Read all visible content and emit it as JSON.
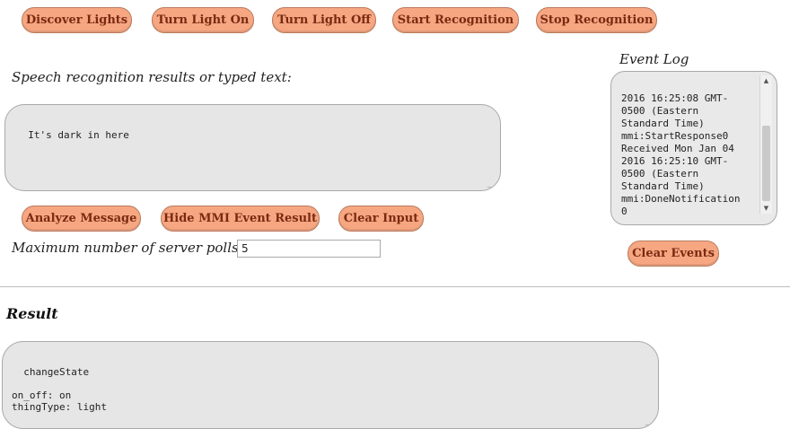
{
  "toolbar": {
    "discover": "Discover Lights",
    "turn_on": "Turn Light On",
    "turn_off": "Turn Light Off",
    "start_recognition": "Start Recognition",
    "stop_recognition": "Stop Recognition"
  },
  "speech": {
    "label": "Speech recognition results or typed text:",
    "value": "It's dark in here"
  },
  "actions": {
    "analyze": "Analyze Message",
    "hide_mmi": "Hide MMI Event Result",
    "clear_input": "Clear Input"
  },
  "polls": {
    "label": "Maximum number of server polls:",
    "value": "5"
  },
  "event_log": {
    "title": "Event Log",
    "text": "2016 16:25:08 GMT-\n0500 (Eastern\nStandard Time)\nmmi:StartResponse0\nReceived Mon Jan 04\n2016 16:25:10 GMT-\n0500 (Eastern\nStandard Time)\nmmi:DoneNotification\n0",
    "clear": "Clear Events"
  },
  "result": {
    "heading": "Result",
    "text": "changeState\n\non_off: on\nthingType: light"
  },
  "colors": {
    "button_bg": "#f6a782",
    "button_text": "#7a2a10",
    "textarea_bg": "#e6e6e6"
  }
}
